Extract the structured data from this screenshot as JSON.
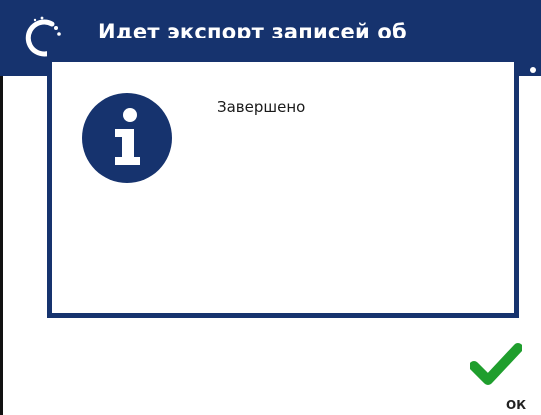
{
  "window": {
    "title": "Идет экспорт записей об"
  },
  "icons": {
    "busy": "busy-spinner-icon",
    "user": "user-icon",
    "info": "info-icon",
    "confirm": "checkmark-icon"
  },
  "dialog": {
    "message": "Завершено"
  },
  "actions": {
    "ok_label": "ОК"
  },
  "colors": {
    "brand": "#16336e",
    "confirm": "#1f9e2d",
    "background": "#ffffff"
  }
}
